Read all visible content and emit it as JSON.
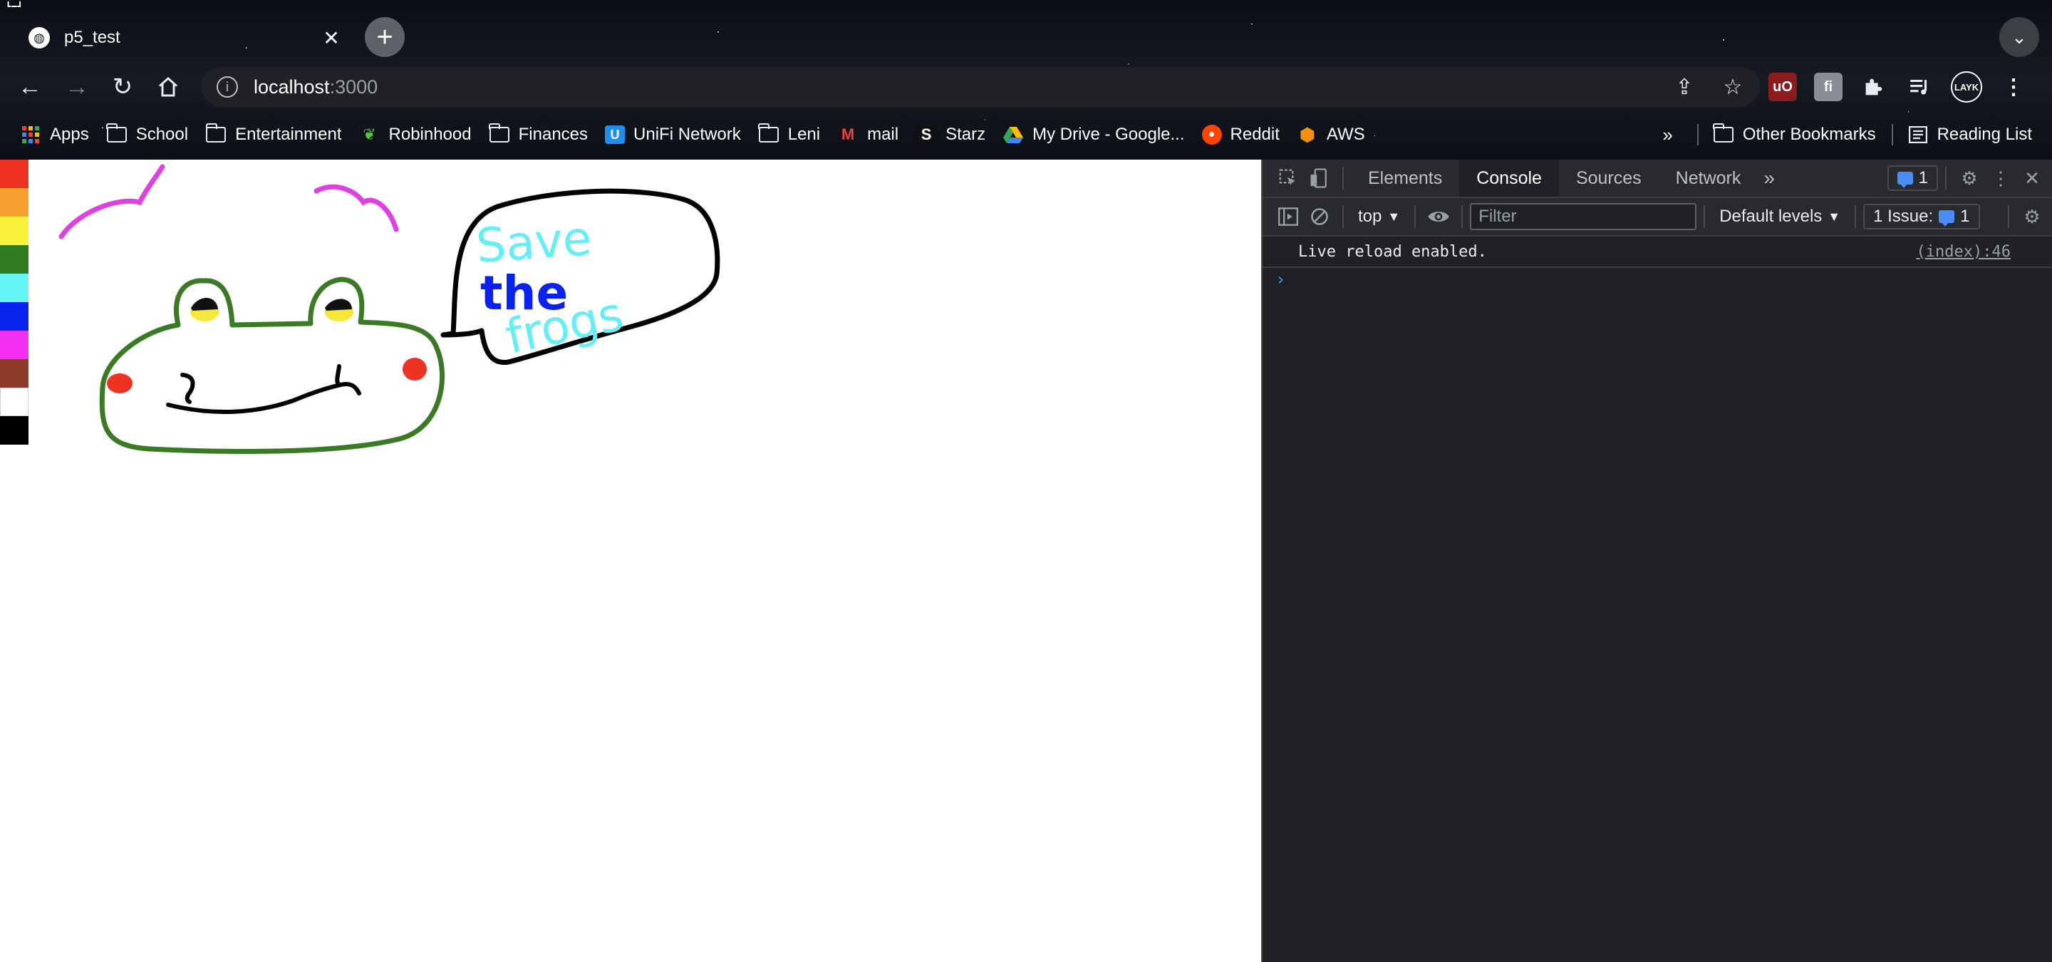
{
  "browser": {
    "tab": {
      "title": "p5_test",
      "favicon_icon": "globe-icon",
      "close_icon": "close-icon"
    },
    "new_tab_icon": "plus-icon",
    "profile_icon": "chevron-down-icon",
    "toolbar": {
      "back_icon": "arrow-left-icon",
      "forward_icon": "arrow-right-icon",
      "reload_icon": "reload-icon",
      "home_icon": "home-icon",
      "url_host": "localhost",
      "url_port": ":3000",
      "share_icon": "share-icon",
      "bookmark_star_icon": "star-icon",
      "extensions": [
        {
          "name": "ublock-icon",
          "label": "uO",
          "color": "#8b1c1c"
        },
        {
          "name": "translate-extension-icon",
          "label": "fi",
          "color": "#8a8d91"
        },
        {
          "name": "puzzle-icon",
          "label": "",
          "color": ""
        },
        {
          "name": "reading-mode-icon",
          "label": "",
          "color": ""
        },
        {
          "name": "profile-avatar-icon",
          "label": "LAYK",
          "color": ""
        }
      ],
      "menu_icon": "kebab-menu-icon"
    },
    "bookmarks": [
      {
        "label": "Apps",
        "icon": "apps-grid-icon"
      },
      {
        "label": "School",
        "icon": "folder-icon"
      },
      {
        "label": "Entertainment",
        "icon": "folder-icon"
      },
      {
        "label": "Robinhood",
        "icon": "robinhood-icon"
      },
      {
        "label": "Finances",
        "icon": "folder-icon"
      },
      {
        "label": "UniFi Network",
        "icon": "unifi-icon"
      },
      {
        "label": "Leni",
        "icon": "folder-icon"
      },
      {
        "label": "mail",
        "icon": "gmail-icon"
      },
      {
        "label": "Starz",
        "icon": "starz-icon"
      },
      {
        "label": "My Drive - Google...",
        "icon": "google-drive-icon"
      },
      {
        "label": "Reddit",
        "icon": "reddit-icon"
      },
      {
        "label": "AWS",
        "icon": "aws-icon"
      }
    ],
    "bookmarks_overflow": "»",
    "other_bookmarks": "Other Bookmarks",
    "reading_list": "Reading List"
  },
  "page": {
    "palette_colors": [
      "#ee3322",
      "#f5a030",
      "#f8f23a",
      "#2e7a1e",
      "#66f5f5",
      "#0a22ee",
      "#f22ef0",
      "#8b3a2a",
      "#ffffff",
      "#000000"
    ],
    "drawing": {
      "speech_words": [
        "Save",
        "the",
        "frogs"
      ],
      "speech_colors": [
        "#66eef5",
        "#0a22ee",
        "#66eef5"
      ],
      "frog_color": "#3a7a25",
      "eye_color": "#f5e83a",
      "cheek_color": "#ee3322",
      "eyebrow_color": "#e040e0"
    }
  },
  "devtools": {
    "inspect_icon": "inspect-element-icon",
    "device_icon": "device-toolbar-icon",
    "tabs": [
      "Elements",
      "Console",
      "Sources",
      "Network"
    ],
    "active_tab": "Console",
    "more_tabs": "»",
    "messages_badge": "1",
    "settings_icon": "gear-icon",
    "more_icon": "kebab-menu-icon",
    "close_icon": "close-icon",
    "sidebar_icon": "sidebar-toggle-icon",
    "clear_icon": "clear-console-icon",
    "context": "top",
    "eye_icon": "eye-icon",
    "filter_placeholder": "Filter",
    "levels": "Default levels",
    "issues_label": "1 Issue:",
    "issues_count": "1",
    "console_messages": [
      {
        "text": "Live reload enabled.",
        "source": "(index):46"
      }
    ],
    "prompt": "›"
  }
}
